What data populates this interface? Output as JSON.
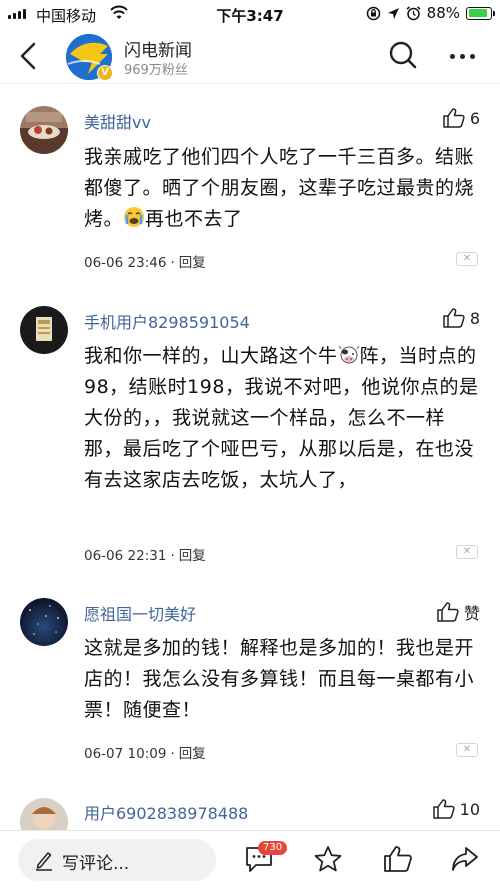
{
  "status_bar": {
    "carrier": "中国移动",
    "time": "下午3:47",
    "battery": "88%",
    "battery_level": 0.88
  },
  "header": {
    "account_name": "闪电新闻",
    "followers": "969万粉丝",
    "verified_badge": "V"
  },
  "comments": [
    {
      "user": "美甜甜vv",
      "likes": "6",
      "text": "我亲戚吃了他们四个人吃了一千三百多。结账都傻了。晒了个朋友圈，这辈子吃过最贵的烧烤。",
      "text_tail": "再也不去了",
      "emoji": "crying-face",
      "date": "06-06 23:46",
      "reply": "回复"
    },
    {
      "user": "手机用户8298591054",
      "likes": "8",
      "text": "我和你一样的，山大路这个牛",
      "text_tail": "阵，当时点的98，结账时198，我说不对吧，他说你点的是大份的，，我说就这一个样品，怎么不一样那，最后吃了个哑巴亏，从那以后是，在也没有去这家店去吃饭，太坑人了，",
      "emoji": "cow-face",
      "date": "06-06 22:31",
      "reply": "回复"
    },
    {
      "user": "愿祖国一切美好",
      "likes": "赞",
      "text": "这就是多加的钱！解释也是多加的！我也是开店的！我怎么没有多算钱！而且每一桌都有小票！随便查！",
      "date": "06-07 10:09",
      "reply": "回复"
    },
    {
      "user": "用户6902838978488",
      "likes": "10"
    }
  ],
  "bottom_bar": {
    "write_placeholder": "写评论...",
    "comment_count": "730"
  },
  "icons": {
    "signal": "signal-icon",
    "wifi": "wifi-icon",
    "back": "back-arrow-icon",
    "search": "search-icon",
    "more": "more-icon",
    "like": "thumbs-up-icon",
    "close": "close-icon",
    "pen": "pen-icon",
    "comment": "comment-bubble-icon",
    "star": "star-icon",
    "share": "share-icon"
  },
  "colors": {
    "username": "#406599",
    "badge": "#e8453c",
    "battery": "#3bd04a"
  }
}
